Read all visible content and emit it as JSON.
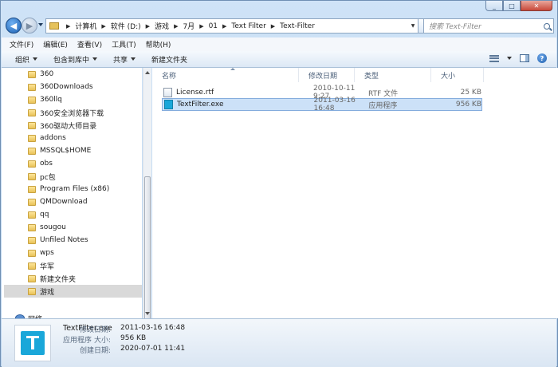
{
  "window": {
    "caption_buttons": [
      "_",
      "□",
      "✕"
    ]
  },
  "address": {
    "crumbs": [
      "计算机",
      "软件 (D:)",
      "游戏",
      "7月",
      "01",
      "Text Filter",
      "Text-Filter"
    ],
    "refresh_glyph": "↻",
    "search_placeholder": "搜索 Text-Filter"
  },
  "menu": {
    "items": [
      "文件(F)",
      "编辑(E)",
      "查看(V)",
      "工具(T)",
      "帮助(H)"
    ]
  },
  "commands": {
    "organize": "组织",
    "include_library": "包含到库中",
    "share": "共享",
    "new_folder": "新建文件夹",
    "help_glyph": "?"
  },
  "nav": {
    "items": [
      "360",
      "360Downloads",
      "360llq",
      "360安全浏览器下载",
      "360驱动大师目录",
      "addons",
      "MSSQL$HOME",
      "obs",
      "pc包",
      "Program Files (x86)",
      "QMDownload",
      "qq",
      "sougou",
      "Unfiled Notes",
      "wps",
      "华军",
      "新建文件夹",
      "游戏"
    ],
    "selected": "游戏",
    "network": "网络"
  },
  "columns": {
    "name": "名称",
    "date": "修改日期",
    "type": "类型",
    "size": "大小"
  },
  "files": [
    {
      "name": "License.rtf",
      "date": "2010-10-11 9:27",
      "type": "RTF 文件",
      "size": "25 KB",
      "icon": "document-icon"
    },
    {
      "name": "TextFilter.exe",
      "date": "2011-03-16 16:48",
      "type": "应用程序",
      "size": "956 KB",
      "icon": "app-icon"
    }
  ],
  "details": {
    "name": "TextFilter.exe",
    "kind": "应用程序",
    "modified_label": "修改日期:",
    "modified": "2011-03-16 16:48",
    "size_label": "大小:",
    "size": "956 KB",
    "created_label": "创建日期:",
    "created": "2020-07-01 11:41"
  }
}
